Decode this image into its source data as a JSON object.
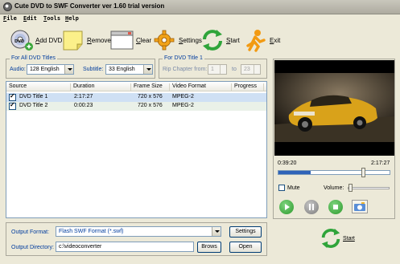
{
  "window": {
    "title": "Cute DVD to SWF Converter ver 1.60  trial version"
  },
  "menu": [
    "File",
    "Edit",
    "Tools",
    "Help"
  ],
  "toolbar": {
    "add_dvd": "Add DVD",
    "remove": "Remove",
    "clear": "Clear",
    "settings": "Settings",
    "start": "Start",
    "exit": "Exit"
  },
  "all_titles": {
    "legend": "For All DVD Titles",
    "audio_label": "Audio:",
    "audio_value": "128  English",
    "subtitle_label": "Subtitle:",
    "subtitle_value": "33  English"
  },
  "title1": {
    "legend": "For DVD Title 1",
    "rip_label": "Rip Chapter from:",
    "from_value": "1",
    "to_label": "to",
    "to_value": "23"
  },
  "table": {
    "columns": [
      "Source",
      "Duration",
      "Frame Size",
      "Video Format",
      "Progress"
    ],
    "rows": [
      {
        "source": "DVD Title 1",
        "duration": "2:17:27",
        "frame": "720 x 576",
        "format": "MPEG-2",
        "progress": ""
      },
      {
        "source": "DVD Title 2",
        "duration": "0:00:23",
        "frame": "720 x 576",
        "format": "MPEG-2",
        "progress": ""
      }
    ]
  },
  "player": {
    "current_time": "0:39:20",
    "total_time": "2:17:27",
    "seek_fraction": 0.29,
    "mute_label": "Mute",
    "volume_label": "Volume:"
  },
  "output": {
    "format_label": "Output Format:",
    "format_value": "Flash SWF Format (*.swf)",
    "settings_button": "Settings",
    "dir_label": "Output Directory:",
    "dir_value": "c:\\videoconverter",
    "browse_button": "Brows",
    "open_button": "Open"
  },
  "start_big": "Start",
  "colors": {
    "selection": "#cfe0f4",
    "accent": "#2f63b8",
    "group_label": "#003c9e"
  }
}
